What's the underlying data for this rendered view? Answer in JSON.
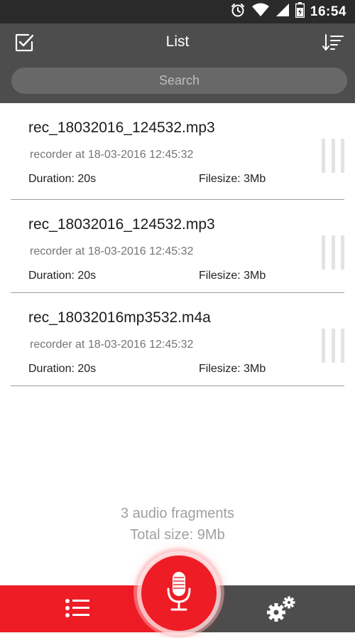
{
  "status_bar": {
    "time": "16:54",
    "icons": [
      "alarm-icon",
      "wifi-icon",
      "signal-icon",
      "battery-icon"
    ]
  },
  "header": {
    "title": "List",
    "left_icon": "checkbox-icon",
    "right_icon": "sort-icon"
  },
  "search": {
    "placeholder": "Search",
    "value": ""
  },
  "recordings": [
    {
      "name": "rec_18032016_124532.mp3",
      "subtitle": "recorder at 18-03-2016 12:45:32",
      "duration": "Duration: 20s",
      "filesize": "Filesize: 3Mb"
    },
    {
      "name": "rec_18032016_124532.mp3",
      "subtitle": "recorder at 18-03-2016 12:45:32",
      "duration": "Duration: 20s",
      "filesize": "Filesize: 3Mb"
    },
    {
      "name": "rec_18032016mp3532.m4a",
      "subtitle": "recorder at 18-03-2016 12:45:32",
      "duration": "Duration: 20s",
      "filesize": "Filesize: 3Mb"
    }
  ],
  "summary": {
    "count": "3 audio fragments",
    "total": "Total size: 9Mb"
  },
  "bottom_bar": {
    "left_icon": "list-icon",
    "center_icon": "microphone-icon",
    "right_icon": "gears-icon"
  },
  "colors": {
    "accent_red": "#ee1c25",
    "header_gray": "#4d4d4d",
    "status_dark": "#2a2a2a"
  }
}
